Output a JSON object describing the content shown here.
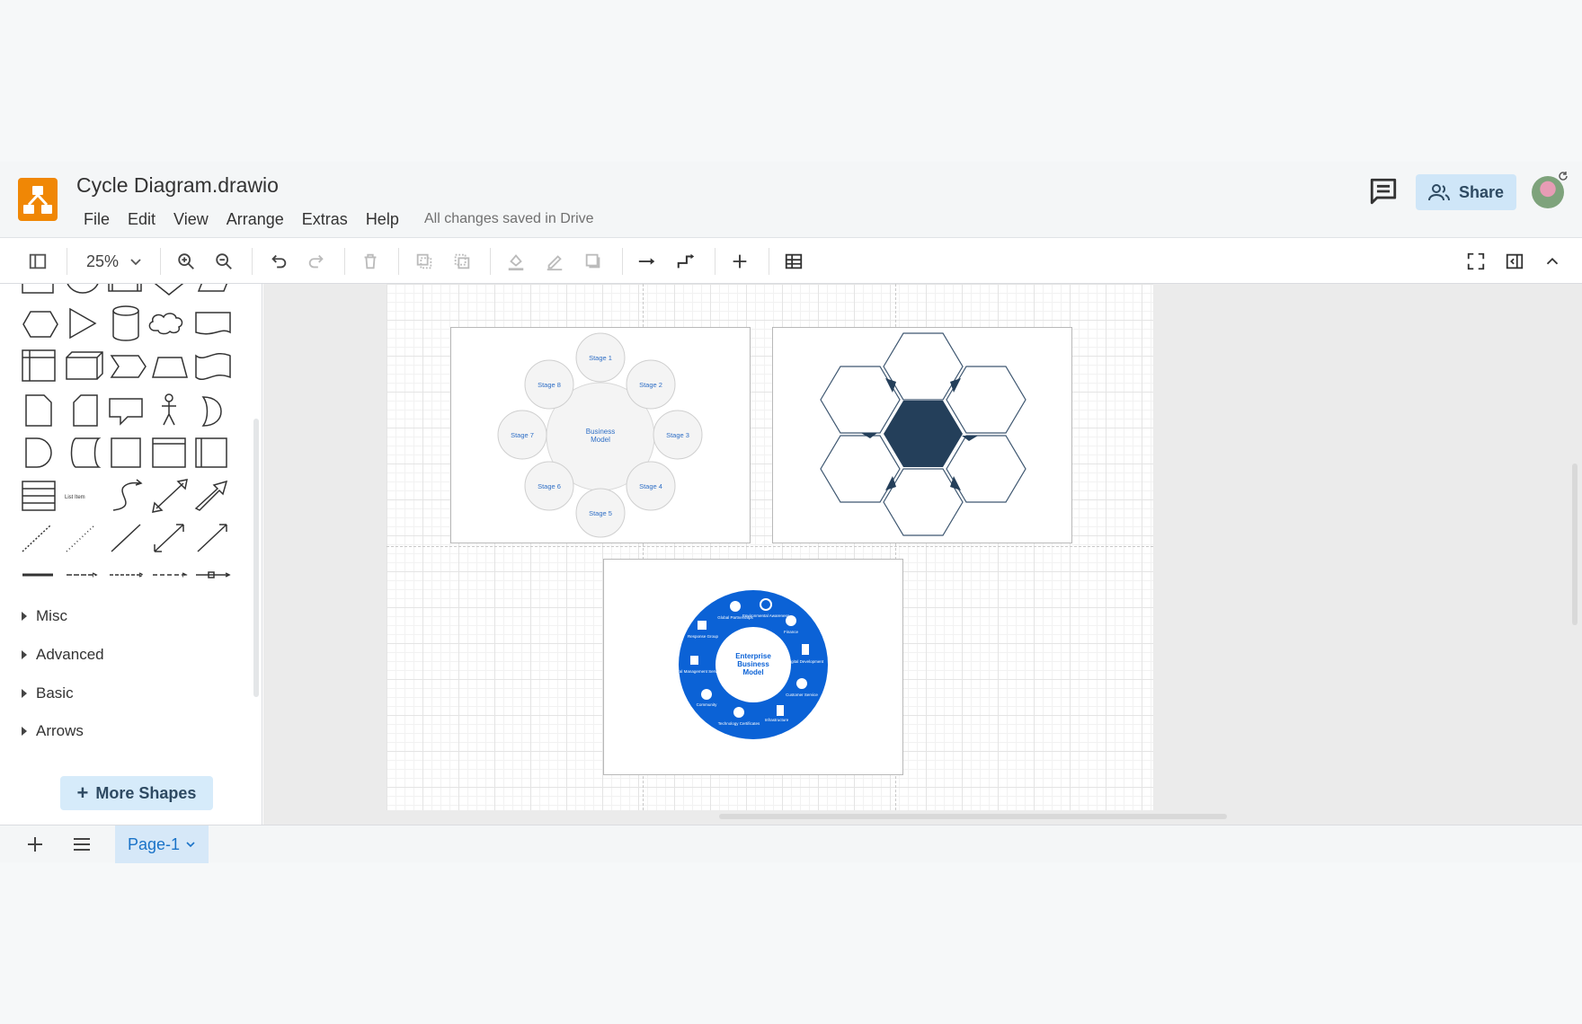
{
  "app": {
    "document_title": "Cycle Diagram.drawio",
    "save_status": "All changes saved in Drive",
    "menus": [
      "File",
      "Edit",
      "View",
      "Arrange",
      "Extras",
      "Help"
    ],
    "share_label": "Share"
  },
  "toolbar": {
    "zoom": "25%",
    "buttons": [
      "format-panel-icon",
      "zoom-in-icon",
      "zoom-out-icon",
      "undo-icon",
      "redo-icon",
      "delete-icon",
      "to-front-icon",
      "to-back-icon",
      "fill-color-icon",
      "line-color-icon",
      "shadow-icon",
      "connection-icon",
      "waypoints-icon",
      "insert-icon",
      "table-icon",
      "fullscreen-icon",
      "toggle-panel-icon",
      "collapse-icon"
    ]
  },
  "sidebar": {
    "list_item_label": "List Item",
    "sections": [
      {
        "label": "Misc"
      },
      {
        "label": "Advanced"
      },
      {
        "label": "Basic"
      },
      {
        "label": "Arrows"
      }
    ],
    "more_shapes_label": "More Shapes"
  },
  "canvas": {
    "cycle_diagram": {
      "center_label_line1": "Business",
      "center_label_line2": "Model",
      "stages": [
        "Stage 1",
        "Stage 2",
        "Stage 3",
        "Stage 4",
        "Stage 5",
        "Stage 6",
        "Stage 7",
        "Stage 8"
      ]
    },
    "enterprise_diagram": {
      "center_line1": "Enterprise",
      "center_line2": "Business",
      "center_line3": "Model",
      "segments": [
        "Global Partnerships",
        "Environmental Awareness",
        "Finance",
        "Digital Development",
        "Customer Service",
        "Infrastructure",
        "Technology Certificates",
        "Community",
        "Central Management Service",
        "Response Group"
      ]
    }
  },
  "footer": {
    "page_tab": "Page-1"
  },
  "colors": {
    "accent": "#1a73c8",
    "logo": "#f08705",
    "hexagon_dark": "#243f5a",
    "enterprise_blue": "#0b62d6"
  }
}
